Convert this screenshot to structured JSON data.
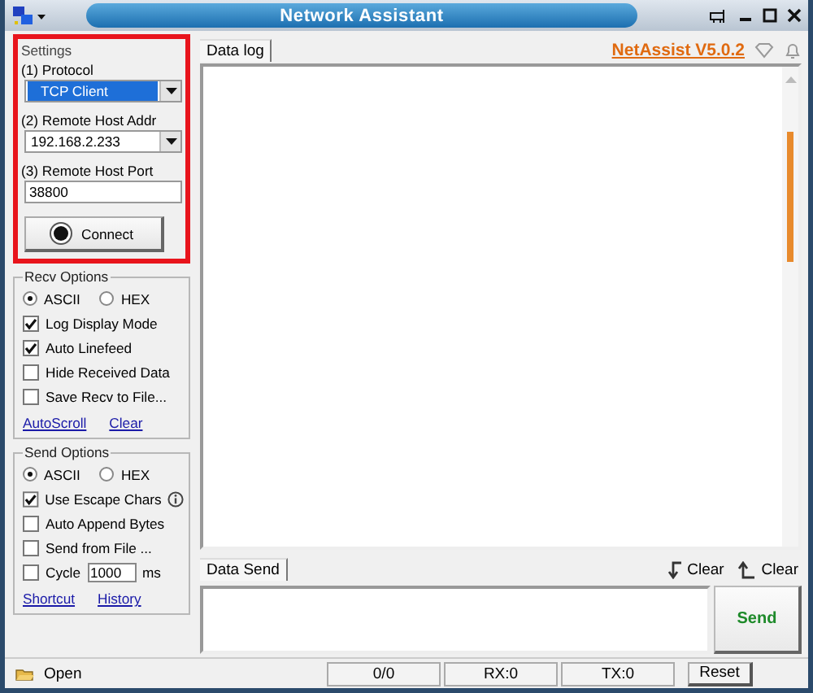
{
  "window": {
    "title": "Network Assistant"
  },
  "settings": {
    "title": "Settings",
    "highlighted": true,
    "protocol_label": "(1) Protocol",
    "protocol": "TCP Client",
    "host_label": "(2) Remote Host Addr",
    "host": "192.168.2.233",
    "port_label": "(3) Remote Host Port",
    "port": "38800",
    "connect_button": "Connect"
  },
  "recv_options": {
    "title": "Recv Options",
    "encodings": [
      {
        "label": "ASCII",
        "selected": true
      },
      {
        "label": "HEX",
        "selected": false
      }
    ],
    "checkboxes": [
      {
        "kind": "plain",
        "label": "Log Display Mode",
        "checked": true
      },
      {
        "kind": "plain",
        "label": "Auto Linefeed",
        "checked": true
      },
      {
        "kind": "plain",
        "label": "Hide Received Data",
        "checked": false
      },
      {
        "kind": "plain",
        "label": "Save Recv to File...",
        "checked": false
      }
    ],
    "links": [
      "AutoScroll",
      "Clear"
    ]
  },
  "send_options": {
    "title": "Send Options",
    "encodings": [
      {
        "label": "ASCII",
        "selected": true
      },
      {
        "label": "HEX",
        "selected": false
      }
    ],
    "checkboxes": [
      {
        "kind": "info",
        "label": "Use Escape Chars",
        "checked": true
      },
      {
        "kind": "plain",
        "label": "Auto Append Bytes",
        "checked": false
      },
      {
        "kind": "plain",
        "label": "Send from File ...",
        "checked": false
      },
      {
        "kind": "cycle",
        "label": "Cycle",
        "checked": false,
        "value": "1000",
        "unit": "ms"
      }
    ],
    "links": [
      "Shortcut",
      "History"
    ]
  },
  "main": {
    "brand": "NetAssist V5.0.2",
    "log_tab": "Data log",
    "send_tab": "Data Send",
    "clear_buttons": [
      {
        "kind": "recv",
        "label": "Clear"
      },
      {
        "kind": "send",
        "label": "Clear"
      }
    ],
    "send_button": "Send"
  },
  "status_bar": {
    "open_label": "Open",
    "counter": "0/0",
    "rx": "RX:0",
    "tx": "TX:0",
    "reset_button": "Reset"
  }
}
